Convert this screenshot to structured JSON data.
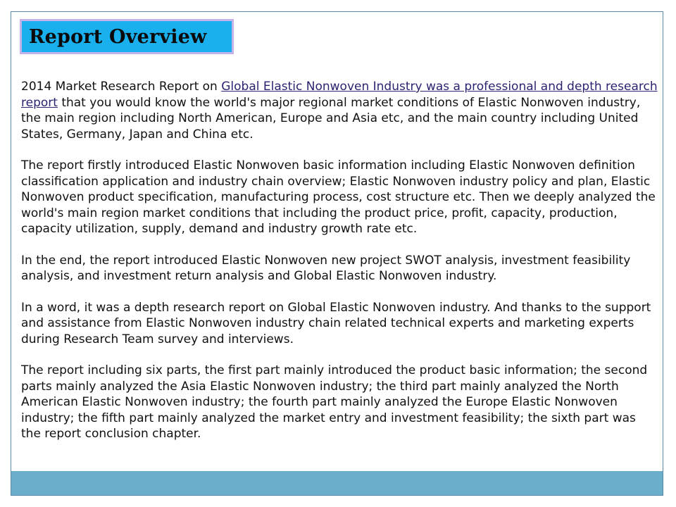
{
  "title": "Report Overview",
  "paragraphs": [
    {
      "before": "2014 Market Research Report on ",
      "link": "Global Elastic Nonwoven Industry was a professional and depth research report",
      "after": " that you would know the world's major regional market conditions of Elastic Nonwoven industry, the main region including North American, Europe and Asia etc, and the main country including United States, Germany, Japan and China etc."
    },
    {
      "text": "The report firstly introduced Elastic Nonwoven basic information including Elastic Nonwoven definition classification application and industry chain overview; Elastic Nonwoven industry policy and plan, Elastic Nonwoven product specification, manufacturing process, cost structure etc. Then we deeply analyzed the world's main region market conditions that including the product price, profit, capacity, production, capacity utilization, supply, demand and industry growth rate etc."
    },
    {
      "text": "In the end, the report introduced Elastic Nonwoven new project SWOT analysis, investment feasibility analysis, and investment return analysis and Global Elastic Nonwoven industry."
    },
    {
      "text": "In a word, it was a depth research report on Global Elastic Nonwoven industry. And thanks to the support and assistance from Elastic Nonwoven industry chain related technical experts and marketing experts during Research Team survey and interviews."
    },
    {
      "text": "The report including six parts, the first part mainly introduced the product basic information; the second parts mainly analyzed the Asia Elastic Nonwoven industry; the third part mainly analyzed the North American Elastic Nonwoven industry; the fourth part mainly analyzed the Europe Elastic Nonwoven industry; the fifth part mainly analyzed the market entry and investment feasibility; the sixth part was the report conclusion chapter."
    }
  ],
  "colors": {
    "title_bg": "#1ab0ee",
    "title_border": "#c3b2ec",
    "link": "#2a2470",
    "footer": "#6aaecb",
    "frame": "#5a86a8"
  }
}
